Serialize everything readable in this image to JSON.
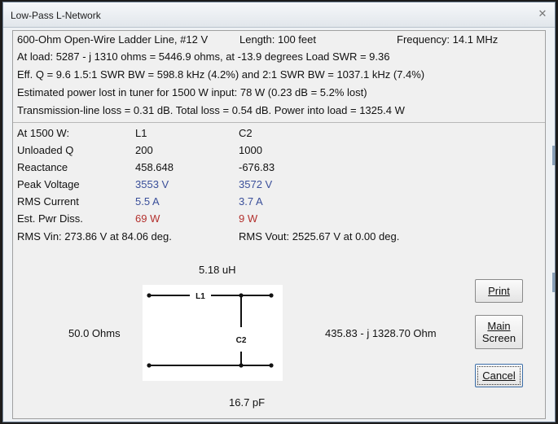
{
  "window": {
    "title": "Low-Pass L-Network",
    "close_glyph": "✕"
  },
  "summary": {
    "line1_left": "600-Ohm Open-Wire Ladder Line, #12 V",
    "length": "Length:   100 feet",
    "frequency": "Frequency:   14.1 MHz",
    "line2": "At load:  5287 - j  1310 ohms = 5446.9 ohms, at -13.9 degrees    Load SWR = 9.36",
    "line3": "Eff. Q = 9.6    1.5:1 SWR BW = 598.8 kHz (4.2%) and 2:1 SWR BW = 1037.1 kHz (7.4%)",
    "line4": "Estimated power lost in tuner for 1500 W input:  78 W (0.23 dB = 5.2% lost)",
    "line5": "Transmission-line loss = 0.31 dB.  Total loss = 0.54 dB.  Power into load = 1325.4 W"
  },
  "table": {
    "header": {
      "label": "At 1500 W:",
      "col1": "L1",
      "col2": "C2"
    },
    "rows": [
      {
        "label": "Unloaded Q",
        "col1": "200",
        "col2": "1000"
      },
      {
        "label": "Reactance",
        "col1": "458.648",
        "col2": "-676.83"
      },
      {
        "label": "Peak Voltage",
        "col1": "3553 V",
        "col2": "3572 V"
      },
      {
        "label": "RMS Current",
        "col1": "5.5 A",
        "col2": "3.7 A"
      },
      {
        "label": "Est. Pwr Diss.",
        "col1": "69 W",
        "col2": "9 W"
      }
    ],
    "rms_vin": "RMS Vin:   273.86 V at 84.06 deg.",
    "rms_vout": "RMS Vout:   2525.67 V at 0.00 deg."
  },
  "schematic": {
    "inductor_value": "5.18 uH",
    "capacitor_value": "16.7 pF",
    "inductor_label": "L1",
    "capacitor_label": "C2",
    "source_impedance": "50.0 Ohms",
    "load_impedance": "435.83 - j 1328.70 Ohm"
  },
  "buttons": {
    "print": "Print",
    "main_line1": "Main",
    "main_line2": "Screen",
    "cancel": "Cancel"
  },
  "colors": {
    "value_blue": "#3a4f9a",
    "value_red": "#b3312e"
  }
}
